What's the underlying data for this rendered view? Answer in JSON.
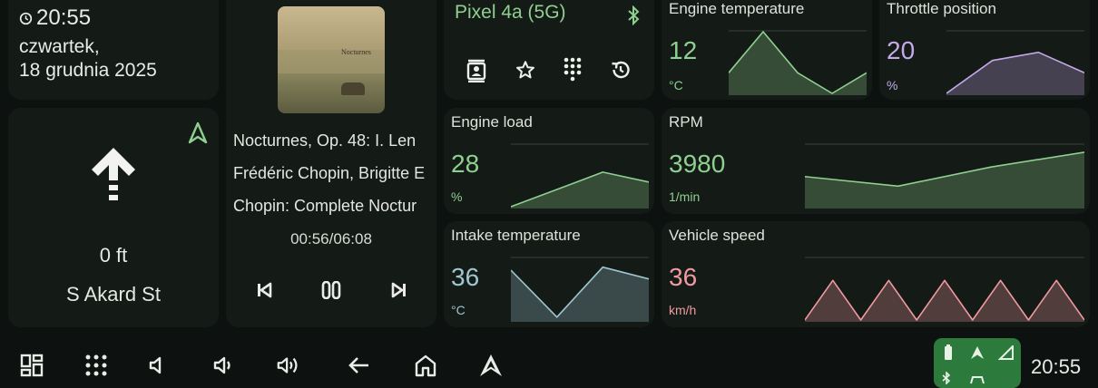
{
  "clock": {
    "time": "20:55",
    "day": "czwartek,",
    "date": "18 grudnia 2025"
  },
  "navigation": {
    "distance": "0 ft",
    "street": "S Akard St",
    "maneuver_icon": "arrow-up-icon",
    "app_icon": "navigation-arrow-icon"
  },
  "media": {
    "title": "Nocturnes, Op. 48: I. Len",
    "artist": "Frédéric Chopin, Brigitte E",
    "album": "Chopin: Complete Noctur",
    "progress_text": "00:56/06:08",
    "album_art_text": "Nocturnes"
  },
  "phone": {
    "device_name": "Pixel 4a (5G)",
    "actions": [
      "contacts-icon",
      "favorites-icon",
      "dialpad-icon",
      "recents-icon"
    ]
  },
  "gauges": {
    "engine_temp": {
      "label": "Engine temperature",
      "value": "12",
      "unit": "°C",
      "color": "#8fcf90",
      "points": [
        4,
        12,
        4,
        0,
        4
      ],
      "min": 0,
      "max": 12
    },
    "throttle": {
      "label": "Throttle position",
      "value": "20",
      "unit": "%",
      "color": "#c4a9e8",
      "points": [
        0,
        16,
        20,
        10
      ],
      "min": 0,
      "max": 30
    },
    "engine_load": {
      "label": "Engine load",
      "value": "28",
      "unit": "%",
      "color": "#8fcf90",
      "points": [
        0,
        14,
        28,
        20
      ],
      "min": 0,
      "max": 50
    },
    "rpm": {
      "label": "RPM",
      "value": "3980",
      "unit": "1/min",
      "color": "#8fcf90",
      "points": [
        2200,
        1500,
        2900,
        3980
      ],
      "min": 0,
      "max": 4500
    },
    "intake_temp": {
      "label": "Intake temperature",
      "value": "36",
      "unit": "°C",
      "color": "#9fc7d2",
      "points": [
        34,
        2,
        36,
        28
      ],
      "min": 0,
      "max": 42
    },
    "vehicle_speed": {
      "label": "Vehicle speed",
      "value": "36",
      "unit": "km/h",
      "color": "#f09aa0",
      "points": [
        0,
        36,
        0,
        36,
        0,
        36,
        0,
        36,
        0,
        36,
        0
      ],
      "min": 0,
      "max": 56
    }
  },
  "bottombar": {
    "clock": "20:55"
  },
  "colors": {
    "background": "#0d1210",
    "card": "#141a16",
    "accent_green": "#8fcf90",
    "status_pill": "#2c7a3c"
  }
}
